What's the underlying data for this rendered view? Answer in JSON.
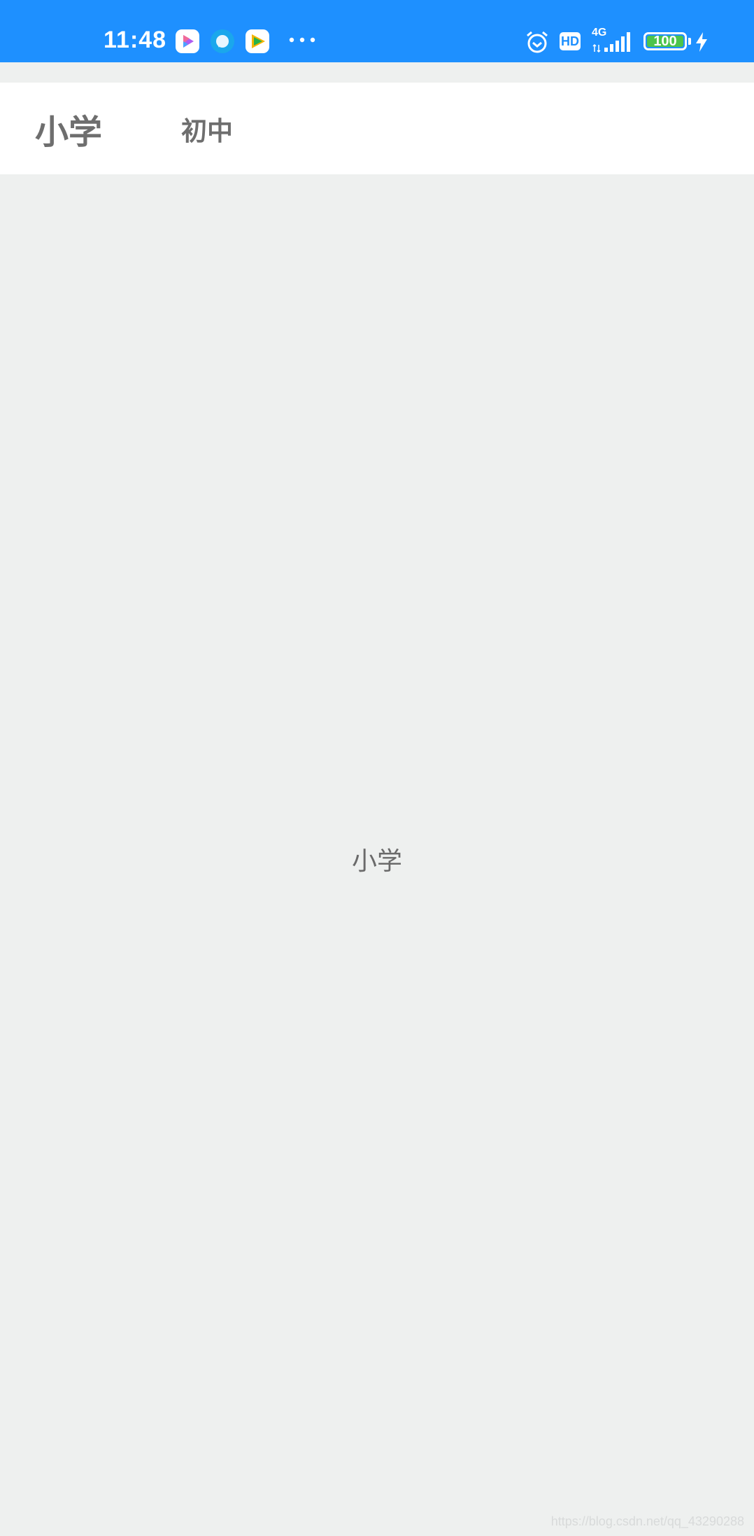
{
  "status_bar": {
    "time": "11:48",
    "app_icons": [
      "video-app-icon",
      "chat-app-icon",
      "player-app-icon"
    ],
    "right_icons": [
      "alarm-icon",
      "hd-icon",
      "signal-4g-icon",
      "battery-icon",
      "charging-icon"
    ],
    "network_label": "4G",
    "hd_label": "HD",
    "battery_level": "100",
    "color": "#1e90ff"
  },
  "tabs": [
    {
      "label": "小学",
      "selected": true
    },
    {
      "label": "初中",
      "selected": false
    }
  ],
  "content": {
    "label": "小学"
  },
  "watermark": "https://blog.csdn.net/qq_43290288"
}
